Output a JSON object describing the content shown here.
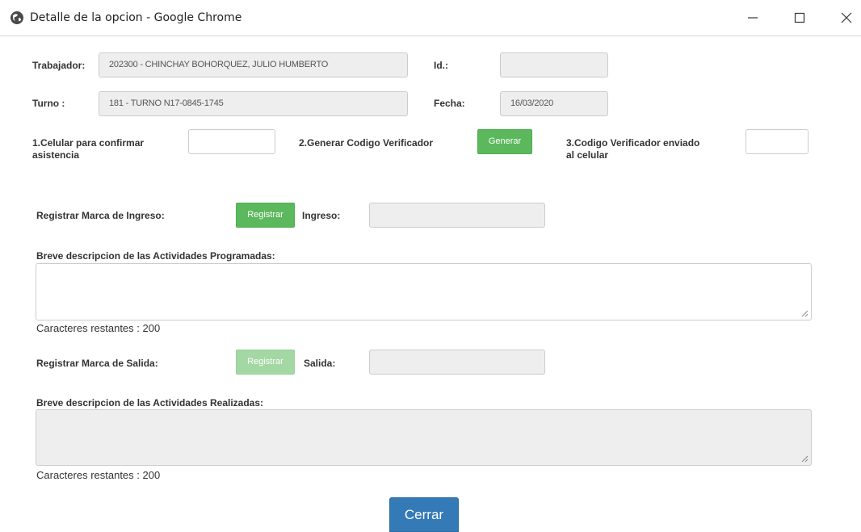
{
  "window": {
    "title": "Detalle de la opcion - Google Chrome",
    "icon": "globe-icon",
    "controls": [
      "minimize-icon",
      "maximize-icon",
      "close-icon"
    ]
  },
  "worker": {
    "label": "Trabajador:",
    "value": "202300 - CHINCHAY BOHORQUEZ, JULIO HUMBERTO",
    "id_label": "Id.:",
    "id_value": ""
  },
  "shift": {
    "label": "Turno :",
    "value": "181 - TURNO N17-0845-1745",
    "date_label": "Fecha:",
    "date_value": "16/03/2020"
  },
  "verification": {
    "step1_label_line1": "1.Celular para confirmar",
    "step1_label_line2": "asistencia",
    "step1_value": "",
    "step2_label": "2.Generar Codigo Verificador",
    "generate_button": "Generar",
    "step3_label_line1": "3.Codigo Verificador enviado",
    "step3_label_line2": "al celular",
    "step3_value": ""
  },
  "entry": {
    "label": "Registrar Marca de Ingreso:",
    "register_button": "Registrar",
    "time_label": "Ingreso:",
    "time_value": "",
    "desc_label": "Breve descripcion de las Actividades Programadas:",
    "desc_value": "",
    "remaining": "Caracteres restantes : 200"
  },
  "exit": {
    "label": "Registrar Marca de Salida:",
    "register_button": "Registrar",
    "time_label": "Salida:",
    "time_value": "",
    "desc_label": "Breve descripcion de las Actividades Realizadas:",
    "desc_value": "",
    "remaining": "Caracteres restantes : 200"
  },
  "footer": {
    "close_button": "Cerrar"
  },
  "colors": {
    "green": "#5cb85c",
    "green_disabled": "#a3d7a3",
    "blue": "#337ab7",
    "field_disabled": "#eeeeee"
  }
}
